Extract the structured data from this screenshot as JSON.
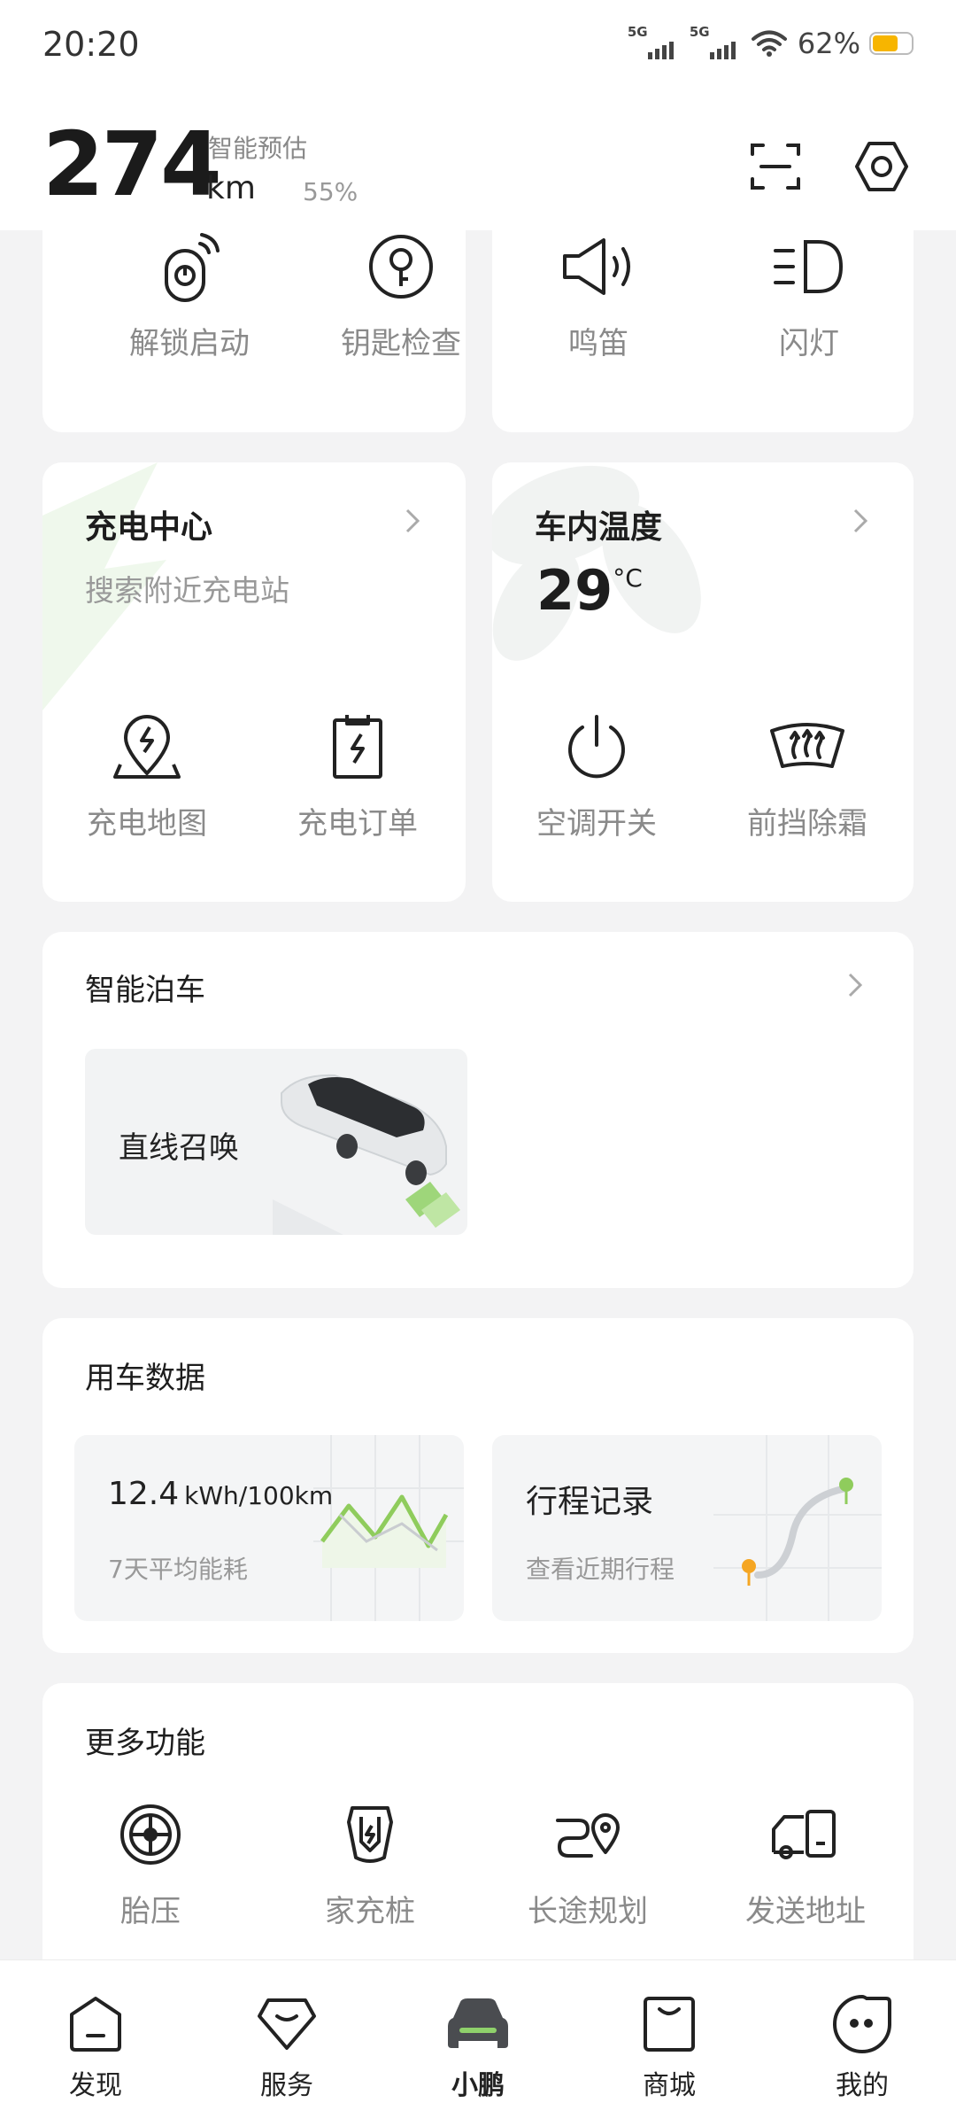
{
  "status_bar": {
    "time": "20:20",
    "sim1": "5G",
    "sim2": "5G",
    "battery": "62%"
  },
  "header": {
    "range_value": "274",
    "range_unit": "km",
    "range_estimate_label": "智能预估",
    "battery_percent": "55%",
    "icons": [
      "scan-icon",
      "settings-icon"
    ]
  },
  "quick_controls": {
    "left": [
      {
        "label": "解锁启动",
        "icon": "remote-start-icon"
      },
      {
        "label": "钥匙检查",
        "icon": "key-icon"
      }
    ],
    "right": [
      {
        "label": "鸣笛",
        "icon": "horn-icon"
      },
      {
        "label": "闪灯",
        "icon": "headlight-icon"
      }
    ]
  },
  "charging": {
    "title": "充电中心",
    "subtitle": "搜索附近充电站",
    "actions": [
      {
        "label": "充电地图",
        "icon": "charge-map-icon"
      },
      {
        "label": "充电订单",
        "icon": "charge-order-icon"
      }
    ]
  },
  "climate": {
    "title": "车内温度",
    "temperature": "29",
    "unit": "°C",
    "actions": [
      {
        "label": "空调开关",
        "icon": "power-icon"
      },
      {
        "label": "前挡除霜",
        "icon": "defrost-icon"
      }
    ]
  },
  "parking": {
    "title": "智能泊车",
    "tile_label": "直线召唤"
  },
  "usage": {
    "title": "用车数据",
    "energy_value": "12.4",
    "energy_unit": "kWh/100km",
    "energy_label": "7天平均能耗",
    "trip_title": "行程记录",
    "trip_label": "查看近期行程"
  },
  "more": {
    "title": "更多功能",
    "items": [
      {
        "label": "胎压",
        "icon": "tire-icon"
      },
      {
        "label": "家充桩",
        "icon": "home-charger-icon"
      },
      {
        "label": "长途规划",
        "icon": "route-icon"
      },
      {
        "label": "发送地址",
        "icon": "send-address-icon"
      }
    ]
  },
  "bottom_nav": {
    "active_color": "#8fd16b",
    "items": [
      {
        "label": "发现",
        "icon": "discover-icon"
      },
      {
        "label": "服务",
        "icon": "service-icon"
      },
      {
        "label": "小鹏",
        "icon": "car-icon"
      },
      {
        "label": "商城",
        "icon": "shop-icon"
      },
      {
        "label": "我的",
        "icon": "profile-icon"
      }
    ],
    "active": "小鹏"
  }
}
